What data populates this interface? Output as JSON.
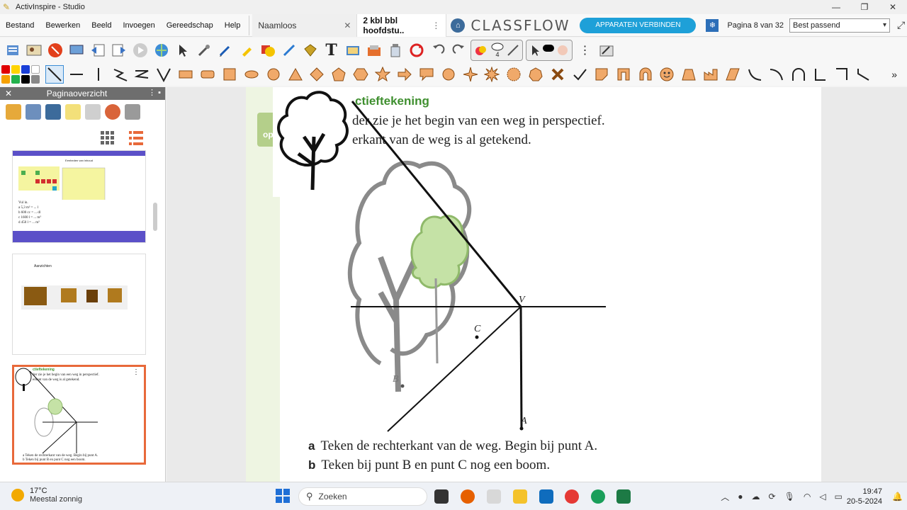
{
  "window": {
    "title": "ActivInspire - Studio",
    "minimize": "—",
    "maximize": "❐",
    "close": "✕"
  },
  "menu": [
    "Bestand",
    "Bewerken",
    "Beeld",
    "Invoegen",
    "Gereedschap",
    "Help"
  ],
  "tabs": [
    {
      "label": "Naamloos",
      "close": "✕"
    },
    {
      "label": "2 kbl bbl hoofdstu..",
      "more": "⋮"
    }
  ],
  "classflow": {
    "brand": "CLASSFLOW",
    "connect_button": "APPARATEN VERBINDEN"
  },
  "pager": {
    "indicator": "Pagina 8 van 32",
    "zoom": "Best passend"
  },
  "toolbar": {
    "pen_count": "4"
  },
  "palette_colors": [
    "#e00000",
    "#ffd400",
    "#1a3fd8",
    "#ffffff",
    "#f5a000",
    "#22b14c",
    "#000000",
    "#888888"
  ],
  "overview": {
    "title": "Paginaoverzicht",
    "thumbnails": [
      {
        "title": "Eenheden van inhoud",
        "lines": [
          "Vul in.",
          "a 5,3 m³ = ... l",
          "b 600 cc = ... dl",
          "c 1600 l = ... m³",
          "d 450 l = ... m³"
        ]
      },
      {
        "title": "Aanzichten"
      },
      {
        "title": "ctieftekening",
        "lines": [
          "der zie je het begin van een weg in perspectief.",
          "erkant van de weg is al getekend.",
          "a Teken de rechterkant van de weg. Begin bij punt A.",
          "b Teken bij punt B en punt C nog een boom."
        ]
      }
    ]
  },
  "page": {
    "heading": "ctieftekening",
    "intro_line1": "der zie je het begin van een weg in perspectief.",
    "intro_line2": "erkant van de weg is al getekend.",
    "point_v": "V",
    "point_c": "C",
    "point_b": "B",
    "point_a": "A",
    "q_a_label": "a",
    "q_a_text": "Teken de rechterkant van de weg. Begin bij punt A.",
    "q_b_label": "b",
    "q_b_text": "Teken bij punt B en punt C nog een boom.",
    "side_tab": "op"
  },
  "taskbar": {
    "temperature": "17°C",
    "weather": "Meestal zonnig",
    "search_placeholder": "Zoeken",
    "time": "19:47",
    "date": "20-5-2024"
  }
}
